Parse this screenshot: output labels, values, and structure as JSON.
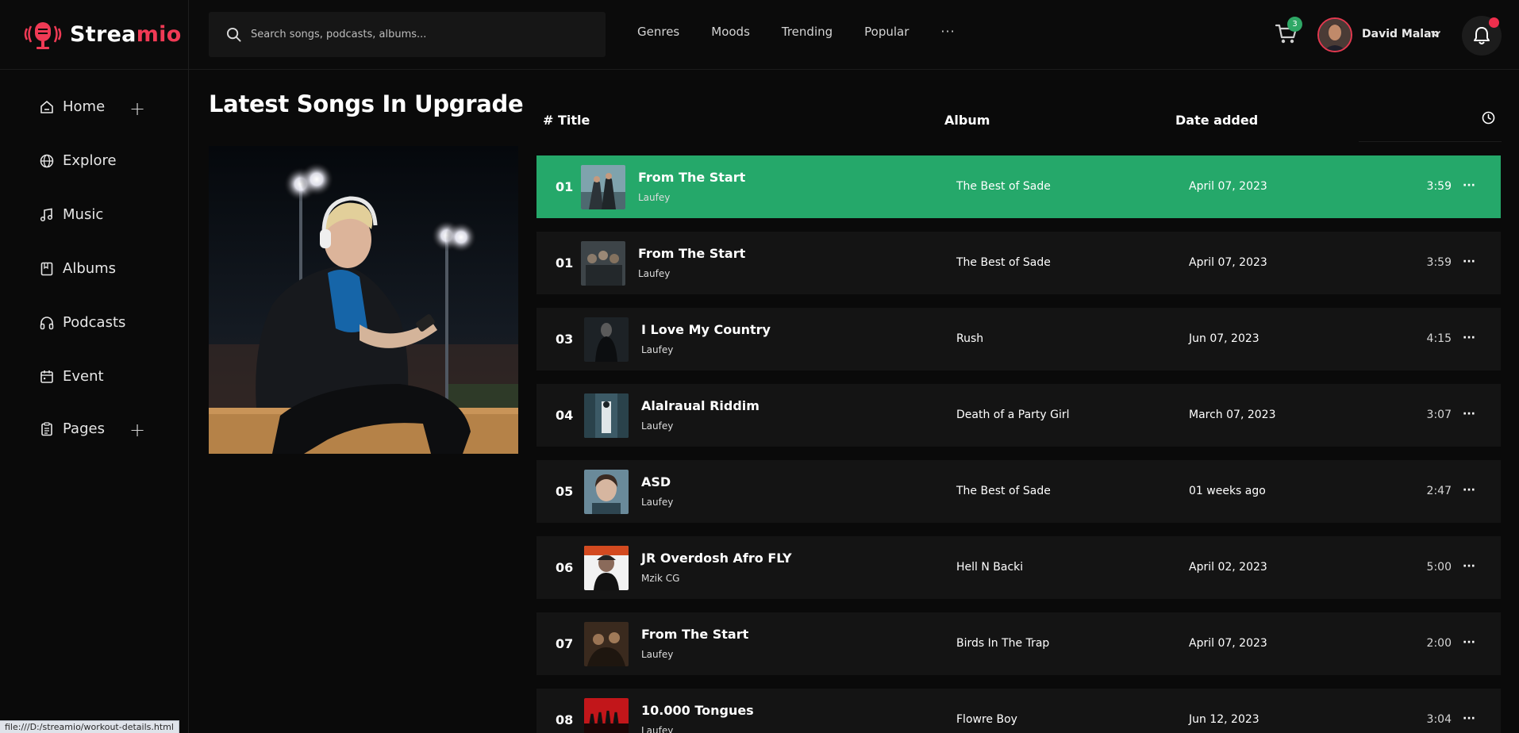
{
  "app": {
    "brand_part1": "Strea",
    "brand_part2": "mio"
  },
  "search": {
    "placeholder": "Search songs, podcasts, albums..."
  },
  "topnav": {
    "items": [
      "Genres",
      "Moods",
      "Trending",
      "Popular"
    ],
    "more": "···"
  },
  "cart": {
    "count": "3"
  },
  "user": {
    "name": "David Malan"
  },
  "sidebar": {
    "items": [
      {
        "label": "Home",
        "icon": "home-icon"
      },
      {
        "label": "Explore",
        "icon": "globe-icon"
      },
      {
        "label": "Music",
        "icon": "music-note-icon"
      },
      {
        "label": "Albums",
        "icon": "album-icon"
      },
      {
        "label": "Podcasts",
        "icon": "headphones-icon"
      },
      {
        "label": "Event",
        "icon": "calendar-icon"
      },
      {
        "label": "Pages",
        "icon": "clipboard-icon"
      }
    ],
    "plus": "+"
  },
  "main": {
    "title": "Latest Songs In Upgrade"
  },
  "table": {
    "headers": {
      "title": "# Title",
      "album": "Album",
      "date": "Date added"
    },
    "more_label": "···",
    "rows": [
      {
        "num": "01",
        "title": "From The Start",
        "artist": "Laufey",
        "album": "The Best of Sade",
        "date": "April 07, 2023",
        "duration": "3:59"
      },
      {
        "num": "01",
        "title": "From The Start",
        "artist": "Laufey",
        "album": "The Best of Sade",
        "date": "April 07, 2023",
        "duration": "3:59"
      },
      {
        "num": "03",
        "title": "I Love My Country",
        "artist": "Laufey",
        "album": "Rush",
        "date": "Jun 07, 2023",
        "duration": "4:15"
      },
      {
        "num": "04",
        "title": "Alalraual Riddim",
        "artist": "Laufey",
        "album": "Death of a Party Girl",
        "date": "March 07, 2023",
        "duration": "3:07"
      },
      {
        "num": "05",
        "title": "ASD",
        "artist": "Laufey",
        "album": "The Best of Sade",
        "date": "01 weeks ago",
        "duration": "2:47"
      },
      {
        "num": "06",
        "title": "JR Overdosh Afro FLY",
        "artist": "Mzik CG",
        "album": "Hell N Backi",
        "date": "April 02, 2023",
        "duration": "5:00"
      },
      {
        "num": "07",
        "title": "From The Start",
        "artist": "Laufey",
        "album": "Birds In The Trap",
        "date": "April 07, 2023",
        "duration": "2:00"
      },
      {
        "num": "08",
        "title": "10.000 Tongues",
        "artist": "Laufey",
        "album": "Flowre Boy",
        "date": "Jun 12, 2023",
        "duration": "3:04"
      }
    ]
  },
  "statusbar": {
    "url": "file:///D:/streamio/workout-details.html"
  },
  "colors": {
    "accent": "#f03a55",
    "active_row": "#25a86a",
    "badge": "#2fa866"
  }
}
